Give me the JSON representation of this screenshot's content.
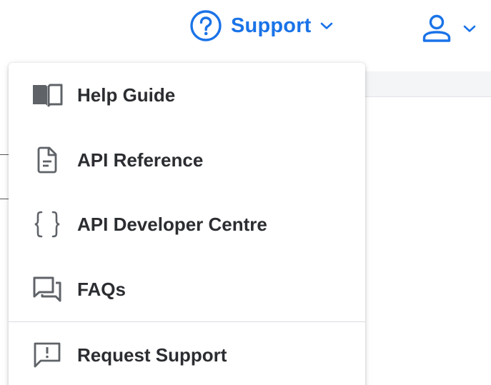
{
  "header": {
    "support": {
      "label": "Support",
      "icon": "question-circle-icon"
    },
    "user_menu": {
      "icon": "user-icon"
    }
  },
  "colors": {
    "accent": "#1a73e8",
    "text": "#2b2d31",
    "icon_gray": "#5f6368"
  },
  "support_menu": {
    "items": [
      {
        "label": "Help Guide",
        "icon": "book-icon"
      },
      {
        "label": "API Reference",
        "icon": "document-icon"
      },
      {
        "label": "API Developer Centre",
        "icon": "curly-braces-icon"
      },
      {
        "label": "FAQs",
        "icon": "chat-bubbles-icon"
      },
      {
        "label": "Request Support",
        "icon": "exclamation-bubble-icon"
      }
    ]
  }
}
